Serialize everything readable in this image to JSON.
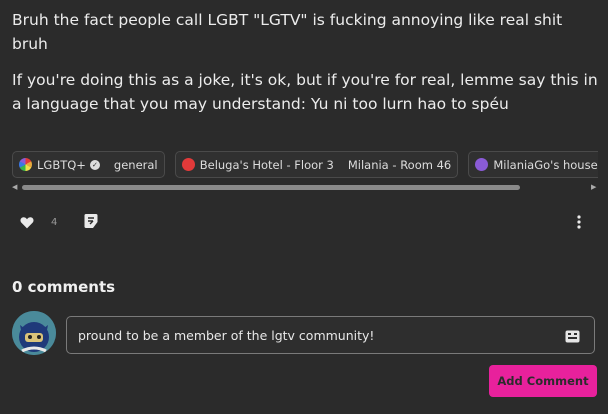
{
  "post": {
    "paragraphs": [
      "Bruh the fact people call LGBT \"LGTV\" is fucking annoying like real shit bruh",
      "If you're doing this as a joke, it's ok, but if you're for real, lemme say this in a language that you may understand: Yu ni too lurn hao to spéu"
    ]
  },
  "tags": [
    {
      "items": [
        "LGBTQ+",
        "general"
      ],
      "icon_color": "#e9a93b",
      "icon": "lgbtq-icon"
    },
    {
      "items": [
        "Beluga's Hotel - Floor 3",
        "Milania - Room 46"
      ],
      "icon_color": "#e23a3a",
      "icon": "hotel-icon"
    },
    {
      "items": [
        "MilaniaGo's house (Ren"
      ],
      "icon_color": "#8a5bd6",
      "icon": "house-icon"
    }
  ],
  "actions": {
    "like_count": "4"
  },
  "comments": {
    "title": "0 comments",
    "input_value": "pround to be a member of the lgtv community!",
    "add_button": "Add Comment"
  },
  "colors": {
    "accent": "#e8219c",
    "background": "#2b2b2b"
  }
}
